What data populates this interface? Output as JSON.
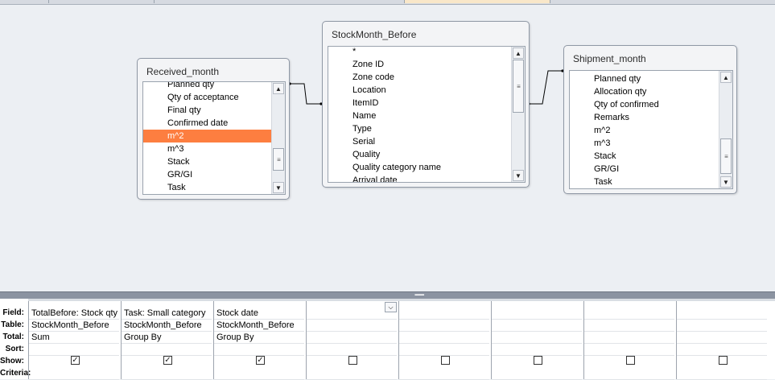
{
  "tables": {
    "received_month": {
      "title": "Received_month",
      "fields": [
        "Planned qty",
        "Qty of acceptance",
        "Final qty",
        "Confirmed date",
        "m^2",
        "m^3",
        "Stack",
        "GR/GI",
        "Task"
      ],
      "selected": "m^2"
    },
    "stockmonth_before": {
      "title": "StockMonth_Before",
      "fields": [
        "*",
        "Zone ID",
        "Zone code",
        "Location",
        "ItemID",
        "Name",
        "Type",
        "Serial",
        "Quality",
        "Quality category name",
        "Arrival date"
      ]
    },
    "shipment_month": {
      "title": "Shipment_month",
      "fields": [
        "Planned qty",
        "Allocation qty",
        "Qty of confirmed",
        "Remarks",
        "m^2",
        "m^3",
        "Stack",
        "GR/GI",
        "Task"
      ]
    }
  },
  "grid": {
    "row_labels": [
      "Field:",
      "Table:",
      "Total:",
      "Sort:",
      "Show:",
      "Criteria:"
    ],
    "columns": [
      {
        "field": "TotalBefore: Stock qty",
        "table": "StockMonth_Before",
        "total": "Sum",
        "sort": "",
        "show": true
      },
      {
        "field": "Task: Small category",
        "table": "StockMonth_Before",
        "total": "Group By",
        "sort": "",
        "show": true
      },
      {
        "field": "Stock date",
        "table": "StockMonth_Before",
        "total": "Group By",
        "sort": "",
        "show": true
      },
      {
        "field": "",
        "table": "",
        "total": "",
        "sort": "",
        "show": false
      },
      {
        "field": "",
        "table": "",
        "total": "",
        "sort": "",
        "show": false
      },
      {
        "field": "",
        "table": "",
        "total": "",
        "sort": "",
        "show": false
      },
      {
        "field": "",
        "table": "",
        "total": "",
        "sort": "",
        "show": false
      },
      {
        "field": "",
        "table": "",
        "total": "",
        "sort": "",
        "show": false
      }
    ]
  },
  "icons": {
    "scroll_up": "triangle-up",
    "scroll_down": "triangle-down",
    "dropdown": "chevron-down",
    "check": "check-mark"
  },
  "colors": {
    "selection": "#fd7e40",
    "design_bg": "#eceff3",
    "splitter": "#8b93a1"
  }
}
